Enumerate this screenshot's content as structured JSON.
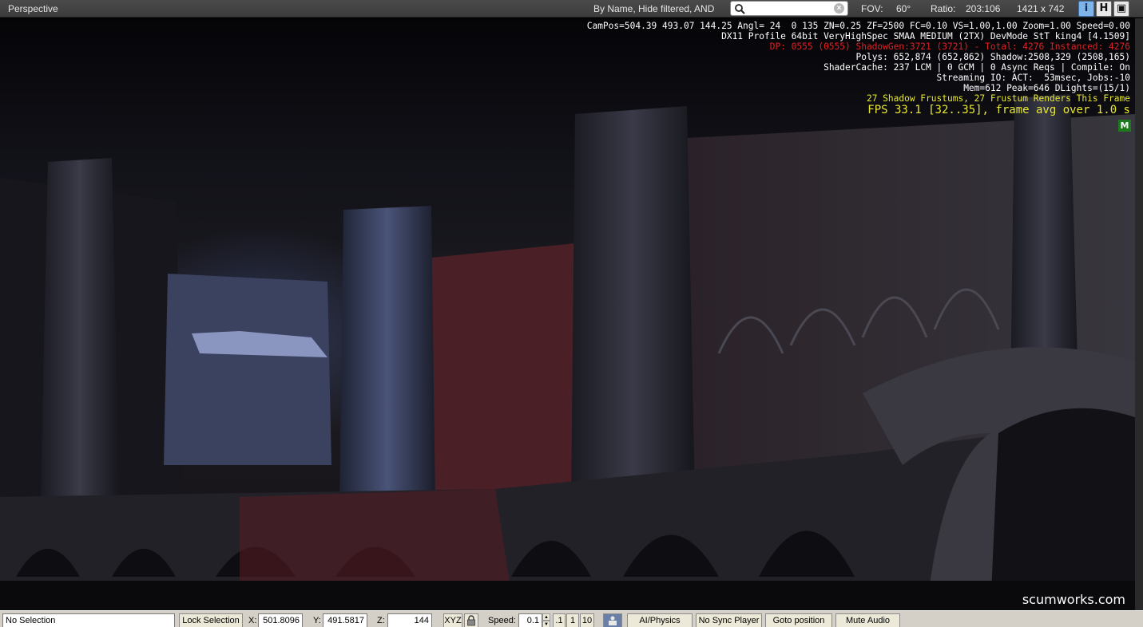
{
  "topbar": {
    "title": "Perspective",
    "filter_label": "By Name, Hide filtered, AND",
    "search_value": "",
    "fov_label": "FOV:",
    "fov_value": "60°",
    "ratio_label": "Ratio:",
    "ratio_value": "203:106",
    "resolution": "1421 x 742",
    "btn_info": "i",
    "btn_h": "H",
    "btn_window": "▣"
  },
  "stats": {
    "line1": "CamPos=504.39 493.07 144.25 Angl= 24  0 135 ZN=0.25 ZF=2500 FC=0.10 VS=1.00,1.00 Zoom=1.00 Speed=0.00",
    "line2": "DX11 Profile 64bit VeryHighSpec SMAA MEDIUM (2TX) DevMode StT king4 [4.1509]",
    "line3": "DP: 0555 (0555) ShadowGen:3721 (3721) - Total: 4276 Instanced: 4276",
    "line4": "Polys: 652,874 (652,862) Shadow:2508,329 (2508,165)",
    "line5": "ShaderCache: 237 LCM | 0 GCM | 0 Async Reqs | Compile: On",
    "line6": "Streaming IO: ACT:  53msec, Jobs:-10",
    "line7": "Mem=612 Peak=646 DLights=(15/1)",
    "line8": "27 Shadow Frustums, 27 Frustum Renders This Frame",
    "fps": "FPS 33.1 [32..35], frame avg over 1.0 s",
    "badge": "M"
  },
  "watermark": "scumworks.com",
  "statusbar": {
    "selection": "No Selection",
    "lock_selection": "Lock Selection",
    "x_label": "X:",
    "x_value": "501.8096",
    "y_label": "Y:",
    "y_value": "491.5817",
    "z_label": "Z:",
    "z_value": "144",
    "xyz": "XYZ",
    "speed_label": "Speed:",
    "speed_value": "0.1",
    "speed_preset_1": ".1",
    "speed_preset_2": "1",
    "speed_preset_3": "10",
    "ai_physics": "AI/Physics",
    "sync_player": "No Sync Player",
    "goto_position": "Goto position",
    "mute_audio": "Mute Audio"
  },
  "colors": {
    "stats_text": "#ffffff",
    "stats_warning": "#e02020",
    "stats_highlight": "#e8e830",
    "badge_green": "#1c7a1c",
    "info_button": "#7fb4e8"
  },
  "icons": {
    "search": "magnifier-icon",
    "clear": "clear-search-icon",
    "lock": "padlock-icon",
    "camera": "camera-icon"
  }
}
